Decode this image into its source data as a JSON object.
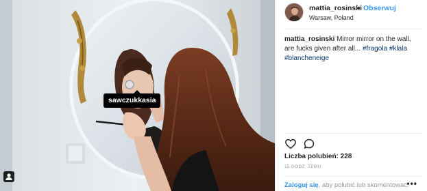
{
  "post": {
    "user_tag": "sawczukkasia"
  },
  "header": {
    "username": "mattia_rosinski",
    "separator": "•",
    "follow_label": "Obserwuj",
    "location": "Warsaw, Poland"
  },
  "caption": {
    "username": "mattia_rosinski",
    "text": " Mirror mirror on the wall, are fucks given after all... ",
    "hashtags": [
      "#fragola",
      "#klala",
      "#blancheneige"
    ]
  },
  "actions": {
    "like_icon": "heart-icon",
    "comment_icon": "comment-icon"
  },
  "likes_label": "Liczba polubień: 228",
  "timestamp": "15 GODZ. TEMU",
  "footer": {
    "login_link": "Zaloguj się",
    "login_text": ", aby polubić lub skomentować.",
    "more_label": "•••"
  },
  "colors": {
    "accent": "#3897f0",
    "hashtag": "#003569",
    "muted": "#999999"
  }
}
